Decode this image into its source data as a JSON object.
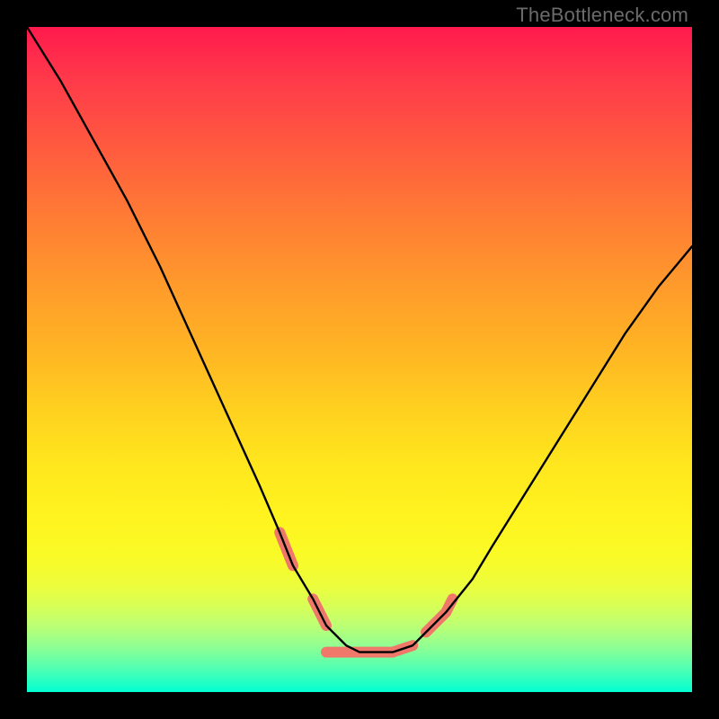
{
  "watermark": "TheBottleneck.com",
  "chart_data": {
    "type": "line",
    "title": "",
    "xlabel": "",
    "ylabel": "",
    "xlim": [
      0,
      100
    ],
    "ylim": [
      0,
      100
    ],
    "background": "rainbow-gradient (red top → green bottom)",
    "series": [
      {
        "name": "curve",
        "color": "#000000",
        "x": [
          0,
          5,
          10,
          15,
          20,
          25,
          30,
          35,
          38,
          40,
          43,
          45,
          48,
          50,
          52,
          55,
          58,
          60,
          63,
          67,
          70,
          75,
          80,
          85,
          90,
          95,
          100
        ],
        "y": [
          100,
          92,
          83,
          74,
          64,
          53,
          42,
          31,
          24,
          19,
          14,
          10,
          7,
          6,
          6,
          6,
          7,
          9,
          12,
          17,
          22,
          30,
          38,
          46,
          54,
          61,
          67
        ]
      },
      {
        "name": "highlight-segments",
        "color": "#f0786a",
        "thickness": 12,
        "segments": [
          {
            "x": [
              38,
              40
            ],
            "y": [
              24,
              19
            ]
          },
          {
            "x": [
              43,
              45
            ],
            "y": [
              14,
              10
            ]
          },
          {
            "x": [
              45,
              55
            ],
            "y": [
              6,
              6
            ]
          },
          {
            "x": [
              55,
              58
            ],
            "y": [
              6,
              7
            ]
          },
          {
            "x": [
              60,
              63
            ],
            "y": [
              9,
              12
            ]
          },
          {
            "x": [
              63,
              64
            ],
            "y": [
              12,
              14
            ]
          }
        ]
      }
    ]
  }
}
